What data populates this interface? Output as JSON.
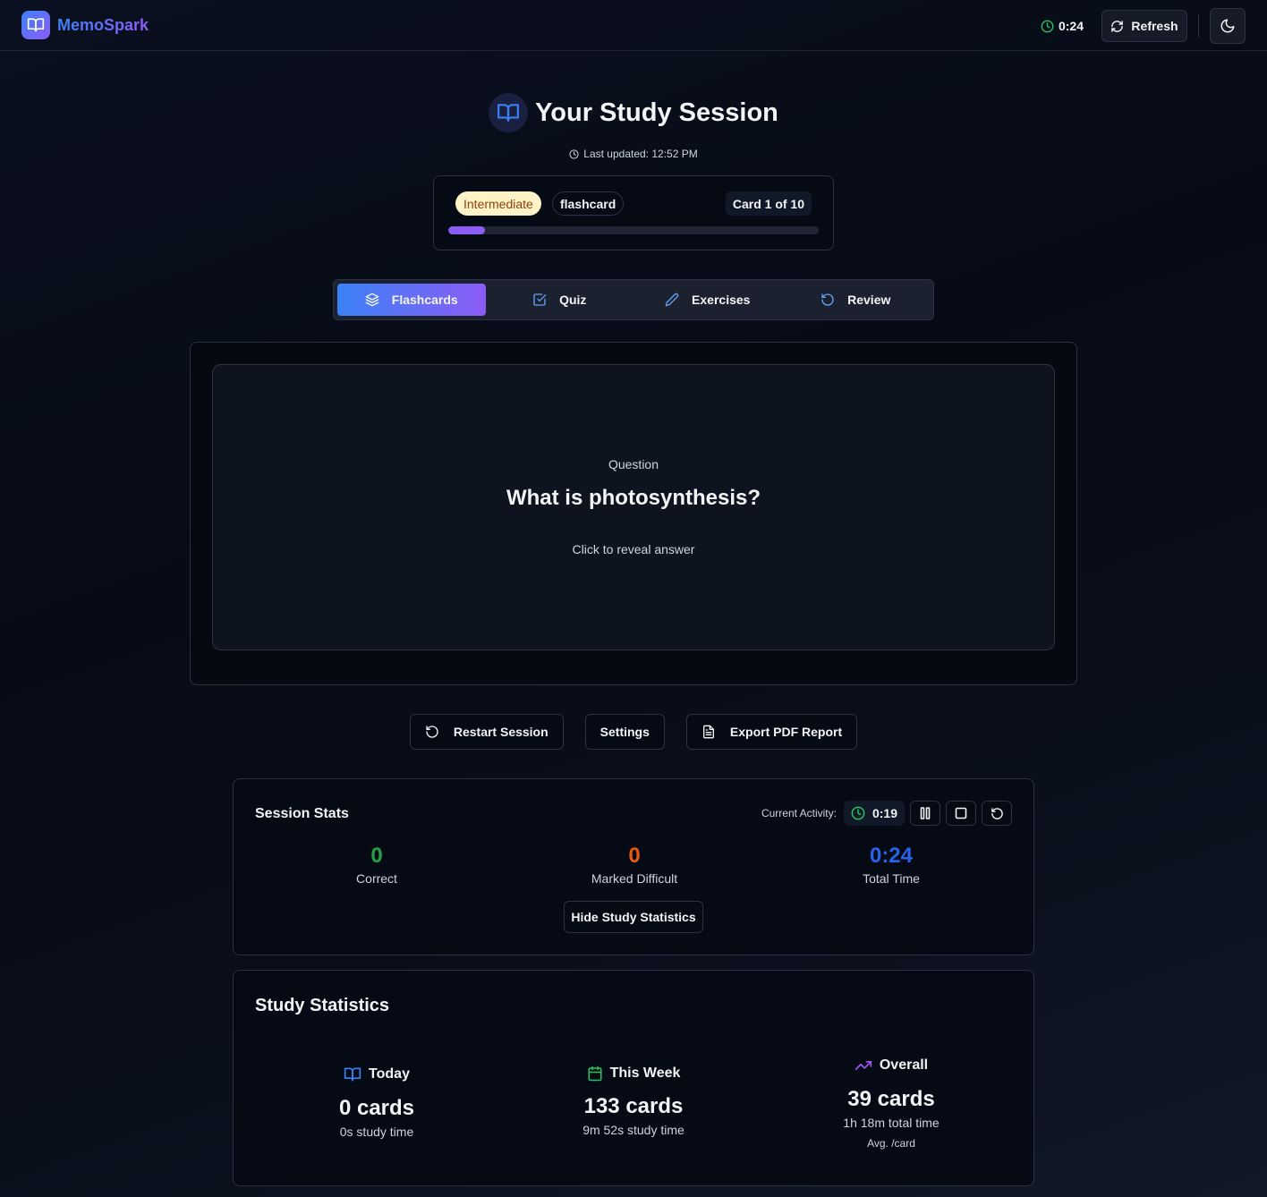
{
  "app": {
    "name": "MemoSpark",
    "timer": "0:24",
    "refresh_label": "Refresh"
  },
  "page": {
    "title": "Your Study Session",
    "last_updated": "Last updated: 12:52 PM"
  },
  "session": {
    "difficulty": "Intermediate",
    "type": "flashcard",
    "card_count": "Card 1 of 10",
    "progress_fraction": 0.1
  },
  "tabs": [
    {
      "label": "Flashcards",
      "icon": "layers-icon",
      "active": true
    },
    {
      "label": "Quiz",
      "icon": "check-square-icon",
      "active": false
    },
    {
      "label": "Exercises",
      "icon": "pencil-icon",
      "active": false
    },
    {
      "label": "Review",
      "icon": "rotate-ccw-icon",
      "active": false
    }
  ],
  "flashcard": {
    "label": "Question",
    "question": "What is photosynthesis?",
    "hint": "Click to reveal answer"
  },
  "actions": {
    "restart": "Restart Session",
    "settings": "Settings",
    "export": "Export PDF Report"
  },
  "session_stats": {
    "title": "Session Stats",
    "activity_label": "Current Activity:",
    "activity_timer": "0:19",
    "correct": {
      "value": "0",
      "label": "Correct",
      "color": "#22a34a"
    },
    "difficult": {
      "value": "0",
      "label": "Marked Difficult",
      "color": "#ea580c"
    },
    "total": {
      "value": "0:24",
      "label": "Total Time",
      "color": "#2563eb"
    },
    "hide_label": "Hide Study Statistics"
  },
  "study_stats": {
    "title": "Study Statistics",
    "today": {
      "label": "Today",
      "cards": "0 cards",
      "sub": "0s study time",
      "icon": "book-icon"
    },
    "week": {
      "label": "This Week",
      "cards": "133 cards",
      "sub": "9m 52s study time",
      "icon": "calendar-icon"
    },
    "overall": {
      "label": "Overall",
      "cards": "39 cards",
      "sub": "1h 18m total time",
      "sub2": "Avg. /card",
      "icon": "trending-up-icon"
    }
  },
  "colors": {
    "accent_blue": "#3b82f6",
    "accent_purple": "#8b5cf6",
    "success": "#22c55e"
  }
}
